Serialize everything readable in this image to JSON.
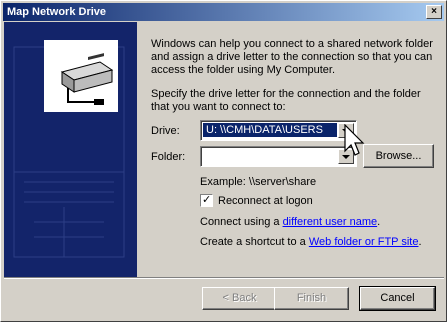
{
  "window": {
    "title": "Map Network Drive",
    "close_glyph": "×"
  },
  "intro": {
    "line1": "Windows can help you connect to a shared network folder",
    "line2": "and assign a drive letter to the connection so that you can",
    "line3": "access the folder using My Computer."
  },
  "instruction": {
    "line1": "Specify the drive letter for the connection and the folder",
    "line2": "that you want to connect to:"
  },
  "drive": {
    "label": "Drive:",
    "value": "U:     \\\\CMH\\DATA\\USERS"
  },
  "folder": {
    "label": "Folder:",
    "value": "",
    "browse_label": "Browse..."
  },
  "example": "Example: \\\\server\\share",
  "reconnect": {
    "label": "Reconnect at logon",
    "checked": true,
    "check_glyph": "✓"
  },
  "connect_using": {
    "prefix": "Connect using a ",
    "link": "different user name",
    "suffix": "."
  },
  "shortcut": {
    "prefix": "Create a shortcut to a ",
    "link": "Web folder or FTP site",
    "suffix": "."
  },
  "buttons": {
    "back": "< Back",
    "finish": "Finish",
    "cancel": "Cancel"
  },
  "icons": [
    "network-drive-icon",
    "mouse-pointer-icon",
    "close-icon",
    "chevron-down-icon",
    "checkmark-icon"
  ],
  "colors": {
    "side_panel": "#13246a",
    "title_start": "#0a246a",
    "title_end": "#a6caf0",
    "link": "#0000ff"
  }
}
